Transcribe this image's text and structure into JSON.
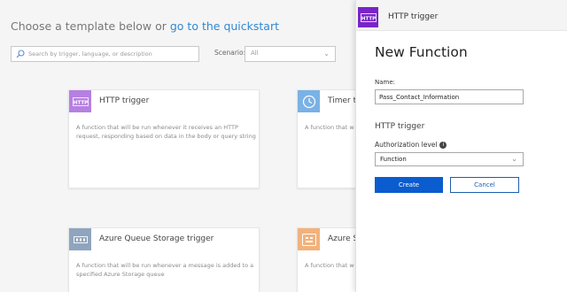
{
  "gallery": {
    "heading_prefix": "Choose a template below or",
    "heading_link": "go to the quickstart",
    "search_placeholder": "Search by trigger, language, or description",
    "scenario_label": "Scenario:",
    "scenario_value": "All",
    "cards": [
      {
        "title": "HTTP trigger",
        "icon": "http-icon",
        "icon_color": "#b680e2",
        "description": "A function that will be run whenever it receives an HTTP request, responding based on data in the body or query string"
      },
      {
        "title": "Timer trig",
        "icon": "clock-icon",
        "icon_color": "#7ab1e6",
        "description": "A function that w"
      },
      {
        "title": "Azure Queue Storage trigger",
        "icon": "queue-icon",
        "icon_color": "#8fa5be",
        "description": "A function that will be run whenever a message is added to a specified Azure Storage queue"
      },
      {
        "title": "Azure Se",
        "icon": "service-bus-icon",
        "icon_color": "#f2b27b",
        "description": "A function that w a specified Servic"
      }
    ]
  },
  "panel": {
    "header_title": "HTTP trigger",
    "header_icon": "http-icon",
    "header_icon_color": "#7a24c8",
    "title": "New Function",
    "name_label": "Name:",
    "name_value": "Pass_Contact_Information",
    "section_title": "HTTP trigger",
    "auth_label": "Authorization level",
    "auth_value": "Function",
    "create_label": "Create",
    "cancel_label": "Cancel"
  }
}
